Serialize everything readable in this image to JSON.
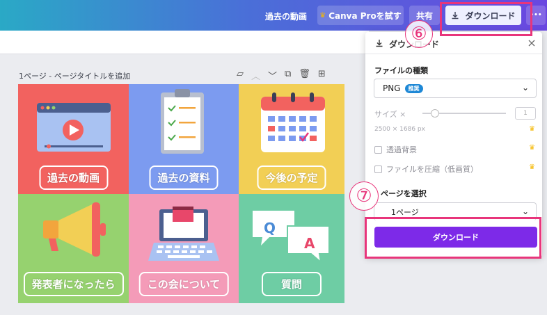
{
  "topbar": {
    "past_video_link": "過去の動画",
    "canva_pro_button": "Canva Proを試す",
    "share_button": "共有",
    "download_button": "ダウンロード",
    "more_button": "•••"
  },
  "canvas": {
    "page_label": "1ページ - ページタイトルを追加",
    "tiles": [
      {
        "label": "過去の動画",
        "color": "#f2625f"
      },
      {
        "label": "過去の資料",
        "color": "#7c9bf0"
      },
      {
        "label": "今後の予定",
        "color": "#f2cf55"
      },
      {
        "label": "発表者になったら",
        "color": "#96d26f"
      },
      {
        "label": "この会について",
        "color": "#f49bb8"
      },
      {
        "label": "質問",
        "color": "#6ecda4"
      }
    ]
  },
  "download_panel": {
    "title": "ダウンロード",
    "file_type_label": "ファイルの種類",
    "file_type_value": "PNG",
    "file_type_badge": "推奨",
    "size_label": "サイズ ×",
    "size_value": "1",
    "dimensions": "2500 × 1686 px",
    "transparent_bg": "透過背景",
    "compress_file": "ファイルを圧縮（低画質）",
    "select_pages_label": "ページを選択",
    "pages_value": "1ページ",
    "download_button": "ダウンロード"
  },
  "annotations": {
    "step6": "⑥",
    "step7": "⑦"
  },
  "colors": {
    "accent_purple": "#7d2ae8",
    "annotation_pink": "#e8357b",
    "crown_gold": "#f5b700"
  }
}
